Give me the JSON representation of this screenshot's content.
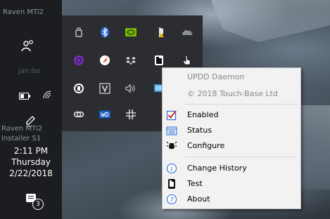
{
  "taskbar": {
    "app_label_top": "Raven MTi2",
    "user_label": "jan.bo",
    "app_label_bottom": "Raven MTi2",
    "installer_label": "Installer S1",
    "clock": {
      "time": "2:11 PM",
      "day": "Thursday",
      "date": "2/22/2018"
    },
    "notification_count": "3"
  },
  "tray": {
    "icons": [
      "usb-drive-icon",
      "bluetooth-icon",
      "nvidia-icon",
      "security-shield-icon",
      "onedrive-cloud-icon",
      "purple-circle-app-icon",
      "feather-app-icon",
      "dropbox-icon",
      "touch-base-icon",
      "hand-pointer-icon",
      "touch-app-icon",
      "v-app-icon",
      "speaker-volume-icon",
      "display-icon",
      "link-chain-icon",
      "wd-icon",
      "gear-sync-icon"
    ]
  },
  "menu": {
    "header": "UPDD Daemon",
    "copyright": "© 2018 Touch-Base Ltd",
    "items": [
      {
        "label": "Enabled",
        "icon": "checkbox-checked-icon"
      },
      {
        "label": "Status",
        "icon": "status-grid-icon"
      },
      {
        "label": "Configure",
        "icon": "configure-mouse-icon"
      },
      {
        "label": "Change History",
        "icon": "info-icon"
      },
      {
        "label": "Test",
        "icon": "test-touch-icon"
      },
      {
        "label": "About",
        "icon": "help-icon"
      }
    ]
  },
  "colors": {
    "taskbar_bg": "#1b1d20",
    "tray_bg": "#2b2d30",
    "menu_bg": "#f2f2f2",
    "disabled_text": "#8a8a8a",
    "checkbox_red": "#d12b2b",
    "icon_blue": "#2f6bd6"
  }
}
